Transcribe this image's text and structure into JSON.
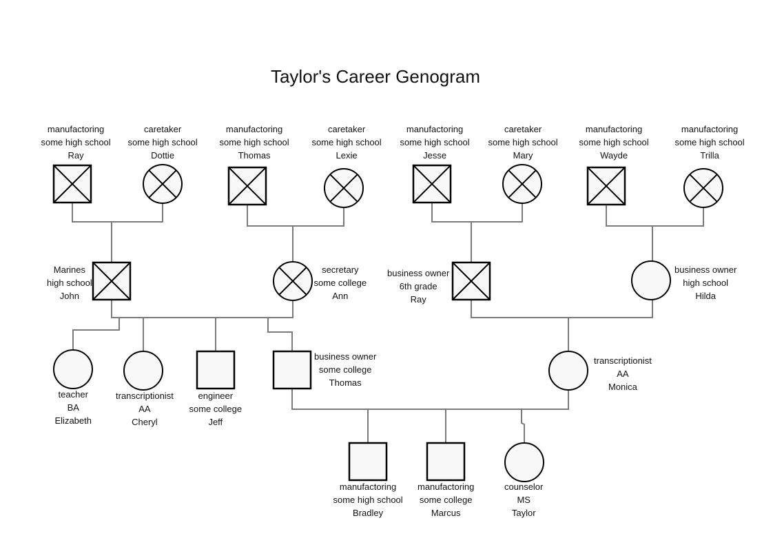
{
  "title": "Taylor's Career Genogram",
  "people": [
    {
      "id": "ray_gp",
      "shape": "square",
      "deceased": true,
      "occupation": "manufactoring",
      "education": "some high school",
      "name": "Ray"
    },
    {
      "id": "dottie",
      "shape": "circle",
      "deceased": true,
      "occupation": "caretaker",
      "education": "some high school",
      "name": "Dottie"
    },
    {
      "id": "thomas_gp",
      "shape": "square",
      "deceased": true,
      "occupation": "manufactoring",
      "education": "some high school",
      "name": "Thomas"
    },
    {
      "id": "lexie",
      "shape": "circle",
      "deceased": true,
      "occupation": "caretaker",
      "education": "some high school",
      "name": "Lexie"
    },
    {
      "id": "jesse",
      "shape": "square",
      "deceased": true,
      "occupation": "manufactoring",
      "education": "some high school",
      "name": "Jesse"
    },
    {
      "id": "mary",
      "shape": "circle",
      "deceased": true,
      "occupation": "caretaker",
      "education": "some high school",
      "name": "Mary"
    },
    {
      "id": "wayde",
      "shape": "square",
      "deceased": true,
      "occupation": "manufactoring",
      "education": "some high school",
      "name": "Wayde"
    },
    {
      "id": "trilla",
      "shape": "circle",
      "deceased": true,
      "occupation": "manufactoring",
      "education": "some high school",
      "name": "Trilla"
    },
    {
      "id": "john",
      "shape": "square",
      "deceased": true,
      "occupation": "Marines",
      "education": "high school",
      "name": "John"
    },
    {
      "id": "ann",
      "shape": "circle",
      "deceased": true,
      "occupation": "secretary",
      "education": "some college",
      "name": "Ann"
    },
    {
      "id": "ray_p",
      "shape": "square",
      "deceased": true,
      "occupation": "business owner",
      "education": "6th grade",
      "name": "Ray"
    },
    {
      "id": "hilda",
      "shape": "circle",
      "deceased": false,
      "occupation": "business owner",
      "education": "high school",
      "name": "Hilda"
    },
    {
      "id": "elizabeth",
      "shape": "circle",
      "deceased": false,
      "occupation": "teacher",
      "education": "BA",
      "name": "Elizabeth"
    },
    {
      "id": "cheryl",
      "shape": "circle",
      "deceased": false,
      "occupation": "transcriptionist",
      "education": "AA",
      "name": "Cheryl"
    },
    {
      "id": "jeff",
      "shape": "square",
      "deceased": false,
      "occupation": "engineer",
      "education": "some college",
      "name": "Jeff"
    },
    {
      "id": "thomas",
      "shape": "square",
      "deceased": false,
      "occupation": "business owner",
      "education": "some college",
      "name": "Thomas"
    },
    {
      "id": "monica",
      "shape": "circle",
      "deceased": false,
      "occupation": "transcriptionist",
      "education": "AA",
      "name": "Monica"
    },
    {
      "id": "bradley",
      "shape": "square",
      "deceased": false,
      "occupation": "manufactoring",
      "education": "some high school",
      "name": "Bradley"
    },
    {
      "id": "marcus",
      "shape": "square",
      "deceased": false,
      "occupation": "manufactoring",
      "education": "some college",
      "name": "Marcus"
    },
    {
      "id": "taylor",
      "shape": "circle",
      "deceased": false,
      "occupation": "counselor",
      "education": "MS",
      "name": "Taylor"
    }
  ],
  "colors": {
    "stroke": "#000000",
    "fill": "#f8f8f8",
    "connector": "#7a7a7a",
    "text": "#111111"
  }
}
